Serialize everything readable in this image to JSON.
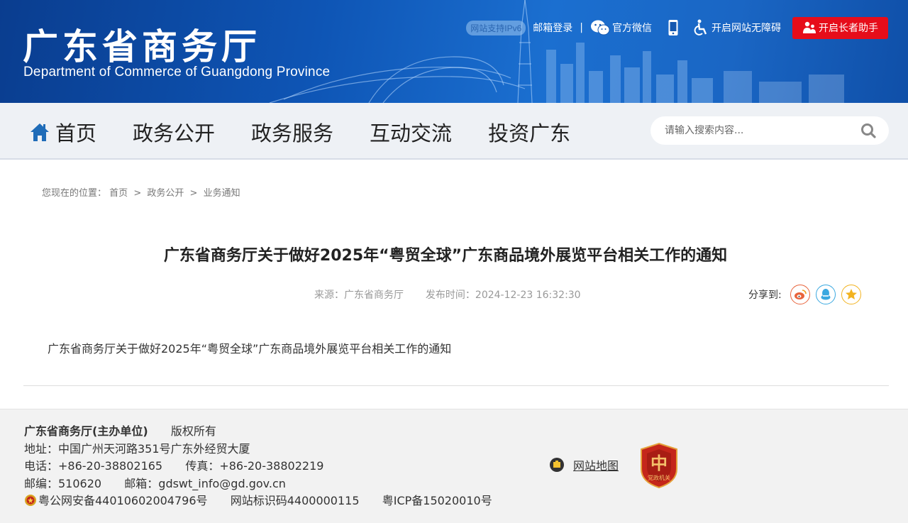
{
  "header": {
    "title": "广东省商务厅",
    "subtitle": "Department of Commerce of Guangdong Province",
    "ipv6_badge": "网站支持IPv6",
    "mail_login": "邮箱登录",
    "separator": "|",
    "wechat": "官方微信",
    "accessibility": "开启网站无障碍",
    "elder_mode": "开启长者助手"
  },
  "nav": {
    "items": [
      {
        "label": "首页",
        "icon": "home-icon"
      },
      {
        "label": "政务公开"
      },
      {
        "label": "政务服务"
      },
      {
        "label": "互动交流"
      },
      {
        "label": "投资广东"
      }
    ],
    "search_placeholder": "请输入搜索内容..."
  },
  "breadcrumb": {
    "prefix": "您现在的位置：",
    "items": [
      "首页",
      "政务公开",
      "业务通知"
    ],
    "arrow": ">"
  },
  "article": {
    "title": "广东省商务厅关于做好2025年“粤贸全球”广东商品境外展览平台相关工作的通知",
    "source": "来源：广东省商务厅",
    "published": "发布时间：2024-12-23 16:32:30",
    "share_label": "分享到:",
    "share_icons": [
      "weibo-icon",
      "qq-icon",
      "qzone-icon"
    ],
    "body": "广东省商务厅关于做好2025年“粤贸全球”广东商品境外展览平台相关工作的通知"
  },
  "footer": {
    "organizer": "广东省商务厅(主办单位)",
    "copyright": "版权所有",
    "address": "地址：中国广州天河路351号广东外经贸大厦",
    "phone": "电话：+86-20-38802165",
    "fax": "传真：+86-20-38802219",
    "postcode": "邮编：510620",
    "email": "邮箱：gdswt_info@gd.gov.cn",
    "police_record": "粤公网安备44010602004796号",
    "site_code": "网站标识码4400000115",
    "icp": "粤ICP备15020010号",
    "sitemap": "网站地图",
    "emblem_text": "党政机关"
  },
  "colors": {
    "banner": "#0e55b5",
    "elder_button": "#e60d1a",
    "nav_bg": "#eef1f5",
    "footer_bg": "#f2f2f2"
  }
}
